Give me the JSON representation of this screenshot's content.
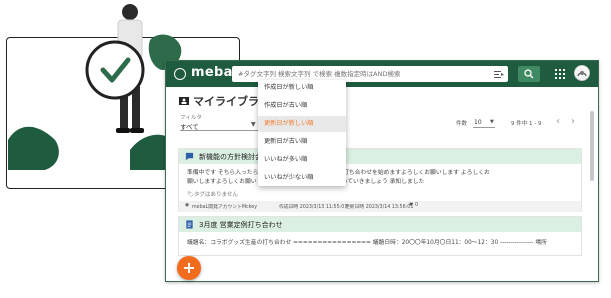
{
  "app": {
    "logo_text": "mebaL",
    "search_placeholder": "#タグ文字列 検索文字列 で検索 複数指定時はAND検索"
  },
  "header": {
    "title": "マイライブラリ"
  },
  "filter": {
    "label": "フィルタ",
    "value": "すべて"
  },
  "pagination": {
    "count_label": "件数",
    "count_value": "10",
    "range_text": "9 件中 1 - 9"
  },
  "sort_menu": {
    "items": [
      "作成日が新しい順",
      "作成日が古い順",
      "更新日が新しい順",
      "更新日が古い順",
      "いいねが多い順",
      "いいねが少ない順"
    ],
    "selected_index": 2,
    "selected_color": "#f07b2c"
  },
  "cards": [
    {
      "title": "新機能の方針検討会",
      "body_line1": "準備中です そちら入ったら … これから製品開発についての打ち合わせを始めますよろしくお願いします よろしくお",
      "body_line2": "願いしますよろしくお願い … ている者手の人い出しから始めていきましょう 承知しました",
      "tags": "タグはありません",
      "author": "mebaL開発アカウントMckey",
      "created": "作成日時 2023/3/13 11:55:07",
      "updated": "更新日時 2023/3/14 13:56:01",
      "likes": "0"
    },
    {
      "title": "3月度 営業定例打ち合わせ",
      "body": "議題名：コラボグッズ生産の打ち合わせ ================ 議題日時：20〇〇年10月〇日11：00〜12：30 ---------------- 場所"
    }
  ],
  "colors": {
    "topbar": "#1e5b3f",
    "card_header": "#dcefe3",
    "fab": "#f26c1e"
  }
}
